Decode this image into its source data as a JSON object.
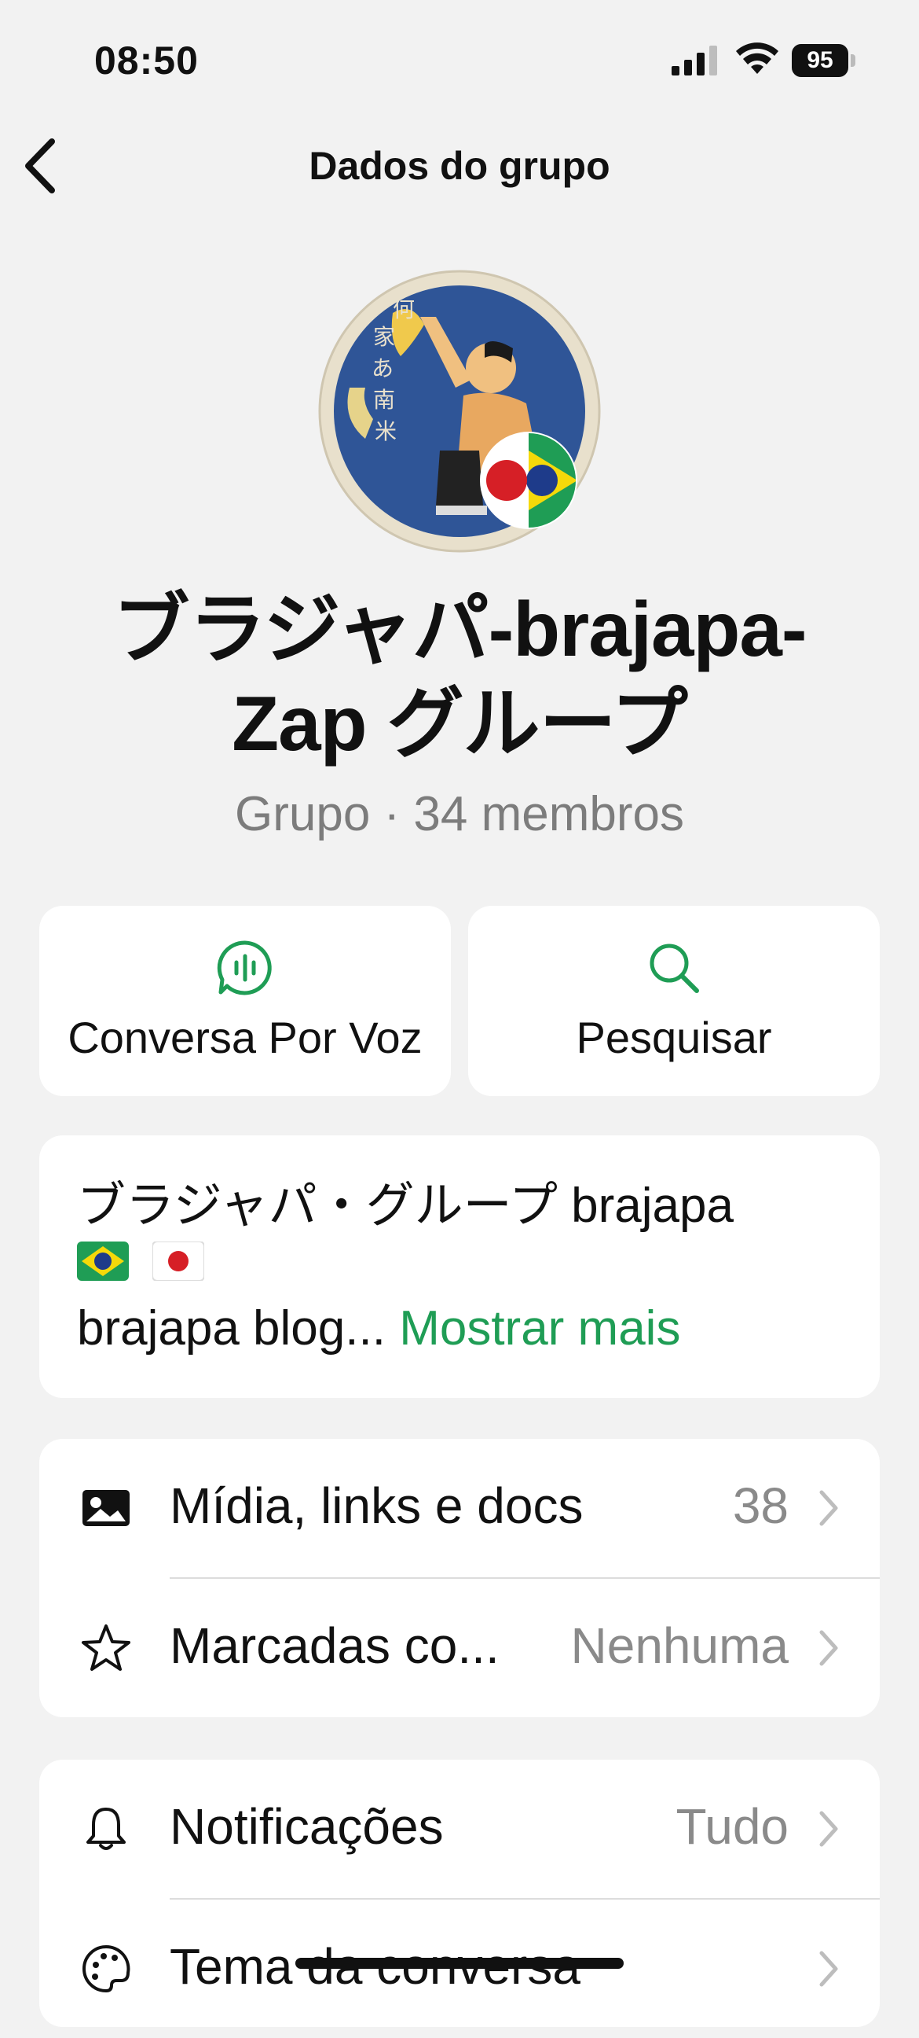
{
  "status_bar": {
    "time": "08:50",
    "battery": "95"
  },
  "nav": {
    "title": "Dados do grupo"
  },
  "group": {
    "name_line1": "ブラジャパ-brajapa-",
    "name_line2": "Zap グループ",
    "subtitle": "Grupo · 34 membros"
  },
  "actions": [
    {
      "label": "Conversa Por Voz",
      "icon": "voice-chat-icon"
    },
    {
      "label": "Pesquisar",
      "icon": "search-icon"
    }
  ],
  "description": {
    "line1": "ブラジャパ・グループ brajapa",
    "flags": [
      "brazil-flag-icon",
      "japan-flag-icon"
    ],
    "line3": "brajapa blog...",
    "show_more": "Mostrar mais"
  },
  "media_section": [
    {
      "label": "Mídia, links e docs",
      "value": "38",
      "icon": "image-icon"
    },
    {
      "label": "Marcadas co...",
      "value": "Nenhuma",
      "icon": "star-icon"
    }
  ],
  "settings_section": [
    {
      "label": "Notificações",
      "value": "Tudo",
      "icon": "bell-icon"
    },
    {
      "label": "Tema da conversa",
      "value": "",
      "icon": "palette-icon"
    }
  ],
  "colors": {
    "accent": "#1f9d55",
    "background": "#f2f2f2",
    "card": "#ffffff"
  }
}
